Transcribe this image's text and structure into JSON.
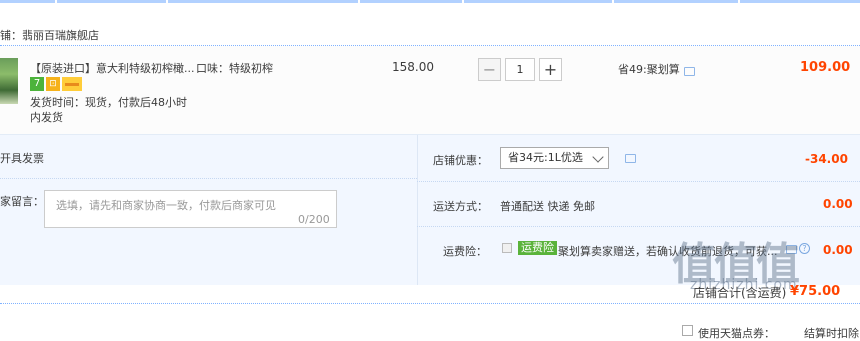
{
  "shop": {
    "prefix": "铺：",
    "name": "翡丽百瑞旗舰店"
  },
  "item": {
    "title": "【原装进口】意大利特级初榨橄...",
    "badges": [
      "7",
      "⊡",
      ""
    ],
    "ship_time_line1": "发货时间：现货，付款后48小时",
    "ship_time_line2": "内发货",
    "sku": "口味：特级初榨",
    "unit_price": "158.00",
    "quantity": "1",
    "minus": "−",
    "plus": "+",
    "save_note": "省49:聚划算",
    "row_total": "109.00"
  },
  "invoice": {
    "label": "开具发票"
  },
  "message": {
    "label": "家留言：",
    "placeholder": "选填，请先和商家协商一致，付款后商家可见",
    "count": "0/200"
  },
  "shop_discount": {
    "label": "店铺优惠：",
    "selected": "省34元:1L优选",
    "value": "-34.00"
  },
  "shipping": {
    "label": "运送方式：",
    "method": "普通配送 快递 免邮",
    "value": "0.00"
  },
  "insurance": {
    "label": "运费险：",
    "tag": "运费险",
    "desc": "聚划算卖家赠送，若确认收货前退货，可获...",
    "help": "?",
    "value": "0.00"
  },
  "summary": {
    "label": "店铺合计(含运费)",
    "value": "¥75.00"
  },
  "points": {
    "label": "使用天猫点券：",
    "note": "结算时扣除"
  },
  "watermark": {
    "text": "值值值",
    "url": "zhizhizhi.com"
  },
  "colors": {
    "accent_red": "#ff4400",
    "divider_blue": "#80b2ff",
    "options_bg": "#f2f7ff",
    "insurance_green": "#5ab33b"
  },
  "icons": [
    "chat-icon",
    "help-icon",
    "checkbox",
    "caret-down-icon"
  ]
}
